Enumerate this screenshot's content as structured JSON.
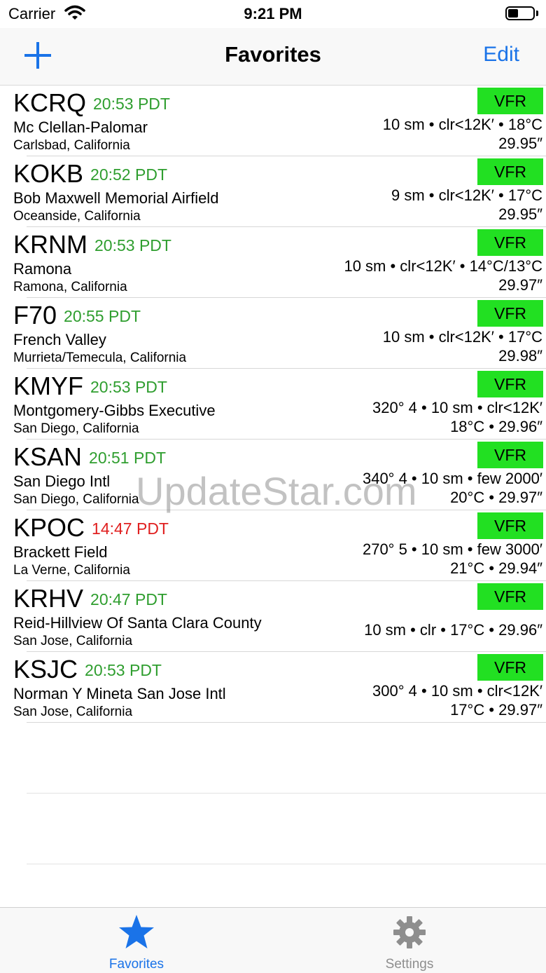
{
  "status_bar": {
    "carrier": "Carrier",
    "time": "9:21 PM"
  },
  "nav": {
    "title": "Favorites",
    "edit_label": "Edit"
  },
  "airports": [
    {
      "ident": "KCRQ",
      "obs_time": "20:53 PDT",
      "name": "Mc Clellan-Palomar",
      "city": "Carlsbad, California",
      "flight_rule": "VFR",
      "wx_line1": "10 sm • clr<12K′ • 18°C",
      "wx_line2": "29.95″"
    },
    {
      "ident": "KOKB",
      "obs_time": "20:52 PDT",
      "name": "Bob Maxwell Memorial Airfield",
      "city": "Oceanside, California",
      "flight_rule": "VFR",
      "wx_line1": "9 sm • clr<12K′ • 17°C",
      "wx_line2": "29.95″"
    },
    {
      "ident": "KRNM",
      "obs_time": "20:53 PDT",
      "name": "Ramona",
      "city": "Ramona, California",
      "flight_rule": "VFR",
      "wx_line1": "10 sm • clr<12K′ • 14°C/13°C",
      "wx_line2": "29.97″"
    },
    {
      "ident": "F70",
      "obs_time": "20:55 PDT",
      "name": "French Valley",
      "city": "Murrieta/Temecula, California",
      "flight_rule": "VFR",
      "wx_line1": "10 sm • clr<12K′ • 17°C",
      "wx_line2": "29.98″"
    },
    {
      "ident": "KMYF",
      "obs_time": "20:53 PDT",
      "name": "Montgomery-Gibbs Executive",
      "city": "San Diego, California",
      "flight_rule": "VFR",
      "wx_line1": "320° 4 • 10 sm • clr<12K′",
      "wx_line2": "18°C • 29.96″"
    },
    {
      "ident": "KSAN",
      "obs_time": "20:51 PDT",
      "name": "San Diego Intl",
      "city": "San Diego, California",
      "flight_rule": "VFR",
      "wx_line1": "340° 4 • 10 sm • few 2000′",
      "wx_line2": "20°C • 29.97″"
    },
    {
      "ident": "KPOC",
      "obs_time": "14:47 PDT",
      "name": "Brackett Field",
      "city": "La Verne, California",
      "flight_rule": "VFR",
      "wx_line1": "270° 5 • 10 sm • few 3000′",
      "wx_line2": "21°C • 29.94″"
    },
    {
      "ident": "KRHV",
      "obs_time": "20:47 PDT",
      "name": "Reid-Hillview Of Santa Clara County",
      "city": "San Jose, California",
      "flight_rule": "VFR",
      "wx_single": "10 sm • clr • 17°C • 29.96″"
    },
    {
      "ident": "KSJC",
      "obs_time": "20:53 PDT",
      "name": "Norman Y Mineta San Jose Intl",
      "city": "San Jose, California",
      "flight_rule": "VFR",
      "wx_line1": "300° 4 • 10 sm • clr<12K′",
      "wx_line2": "17°C • 29.97″"
    }
  ],
  "watermark": "UpdateStar.com",
  "tabs": {
    "favorites": "Favorites",
    "settings": "Settings"
  },
  "colors": {
    "accent": "#1a73e8",
    "vfr": "#22e022",
    "fresh_time": "#2f9e2f",
    "stale_time": "#e02020"
  },
  "icons": {
    "add": "plus-icon",
    "favorites": "star-icon",
    "settings": "gear-icon"
  }
}
